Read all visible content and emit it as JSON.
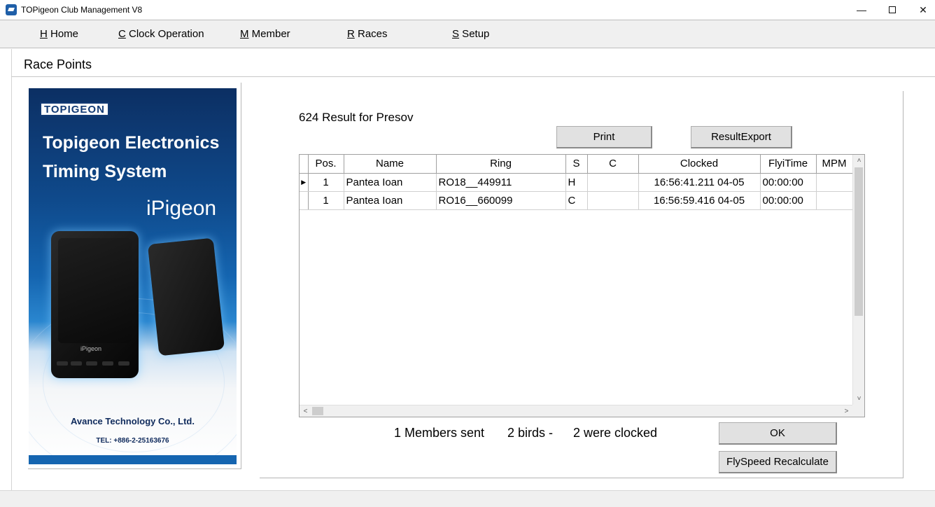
{
  "window": {
    "title": "TOPigeon Club Management V8",
    "min_glyph": "—",
    "close_glyph": "✕"
  },
  "menu": [
    {
      "key": "H",
      "label": " Home"
    },
    {
      "key": "C",
      "label": " Clock Operation"
    },
    {
      "key": "M",
      "label": " Member"
    },
    {
      "key": "R",
      "label": " Races"
    },
    {
      "key": "S",
      "label": " Setup"
    }
  ],
  "page": {
    "title": "Race Points"
  },
  "banner": {
    "logo": "TOPIGEON",
    "headline_1": "Topigeon Electronics",
    "headline_2": "Timing System",
    "product": "iPigeon",
    "device_label": "iPigeon",
    "company": "Avance Technology Co., Ltd.",
    "tel": "TEL: +886-2-25163676",
    "colors": {
      "dark_blue": "#0c2f63",
      "mid_blue": "#1565b0",
      "stripe": "#1565b0"
    }
  },
  "results": {
    "title": "624 Result for Presov",
    "print_label": "Print",
    "export_label": "ResultExport",
    "columns": [
      "",
      "Pos.",
      "Name",
      "Ring",
      "S",
      "C",
      "Clocked",
      "FlyiTime",
      "MPM"
    ],
    "rows": [
      {
        "selector": "▶",
        "pos": "1",
        "name": "Pantea Ioan",
        "ring": "RO18__449911",
        "s": "H",
        "c": "",
        "clocked": "16:56:41.211  04-05",
        "flytime": "00:00:00",
        "mpm": ""
      },
      {
        "selector": "",
        "pos": "1",
        "name": "Pantea Ioan",
        "ring": "RO16__660099",
        "s": "C",
        "c": "",
        "clocked": "16:56:59.416  04-05",
        "flytime": "00:00:00",
        "mpm": ""
      }
    ]
  },
  "summary": {
    "members": "1 Members sent",
    "birds": "2 birds -",
    "clocked": "2 were clocked"
  },
  "actions": {
    "ok_label": "OK",
    "recalc_label": "FlySpeed Recalculate"
  },
  "scroll": {
    "up": "˄",
    "down": "˅",
    "left": "<",
    "right": ">"
  }
}
